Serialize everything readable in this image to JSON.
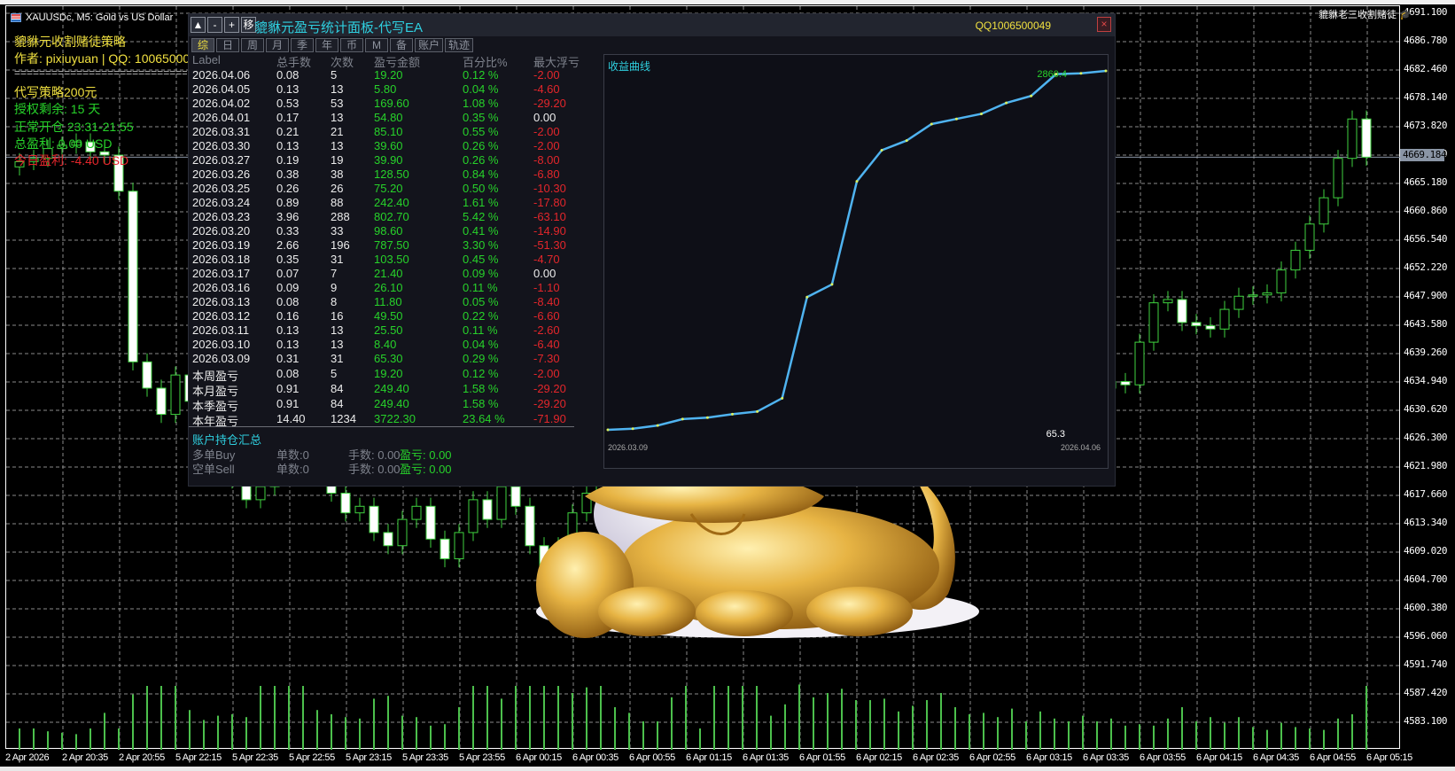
{
  "chart_header": {
    "title": "XAUUSDc, M5:  Gold vs US Dollar",
    "signature": "貔貅老三收割赌徒"
  },
  "overlay": {
    "strategy": "貔貅元收割赌徒策略",
    "author": "作者: pixiuyuan | QQ: 1006500049",
    "divider": "=================================",
    "ad": "代写策略200元",
    "license": "授权剩余: 15 天",
    "hours": "正常开仓 23:31-21:55",
    "total_profit": "总盈利: 0.00 USD",
    "today_profit": "今日盈利: -4.40 USD"
  },
  "price_axis": [
    "4691.100",
    "4686.780",
    "4682.460",
    "4678.140",
    "4673.820",
    "4669.500",
    "4665.180",
    "4660.860",
    "4656.540",
    "4652.220",
    "4647.900",
    "4643.580",
    "4639.260",
    "4634.940",
    "4630.620",
    "4626.300",
    "4621.980",
    "4617.660",
    "4613.340",
    "4609.020",
    "4604.700",
    "4600.380",
    "4596.060",
    "4591.740",
    "4587.420",
    "4583.100"
  ],
  "current_price": "4669.184",
  "time_axis": [
    "2 Apr 2026",
    "2 Apr 20:35",
    "2 Apr 20:55",
    "5 Apr 22:15",
    "5 Apr 22:35",
    "5 Apr 22:55",
    "5 Apr 23:15",
    "5 Apr 23:35",
    "5 Apr 23:55",
    "6 Apr 00:15",
    "6 Apr 00:35",
    "6 Apr 00:55",
    "6 Apr 01:15",
    "6 Apr 01:35",
    "6 Apr 01:55",
    "6 Apr 02:15",
    "6 Apr 02:35",
    "6 Apr 02:55",
    "6 Apr 03:15",
    "6 Apr 03:35",
    "6 Apr 03:55",
    "6 Apr 04:15",
    "6 Apr 04:35",
    "6 Apr 04:55",
    "6 Apr 05:15"
  ],
  "candles_close": [
    4668.5,
    4669,
    4670.5,
    4671,
    4671.5,
    4670,
    4669.5,
    4664,
    4638,
    4634,
    4630,
    4636,
    4632,
    4628,
    4624,
    4620,
    4617,
    4619,
    4622,
    4626,
    4624,
    4621,
    4618,
    4615,
    4616,
    4612,
    4610,
    4614,
    4616,
    4611,
    4608,
    4612,
    4617,
    4614,
    4619,
    4616,
    4610,
    4604,
    4610,
    4615,
    4618,
    4620,
    4622,
    4621,
    4624,
    4626,
    4625,
    4627,
    4629,
    4628,
    4630,
    4632,
    4631,
    4633,
    4634,
    4632,
    4630,
    4633,
    4635,
    4636,
    4634,
    4632,
    4631,
    4633,
    4635,
    4637,
    4636,
    4634,
    4633,
    4632,
    4634,
    4635,
    4633,
    4632,
    4634,
    4633,
    4634,
    4635,
    4634.5,
    4641,
    4647,
    4647.5,
    4644,
    4643.5,
    4643,
    4646,
    4648,
    4648.2,
    4648.5,
    4652,
    4655,
    4659,
    4663,
    4669,
    4675,
    4669.184
  ],
  "volume_levels": [
    30,
    30,
    26,
    24,
    22,
    30,
    52,
    30,
    78,
    90,
    90,
    90,
    56,
    42,
    48,
    50,
    46,
    90,
    90,
    90,
    90,
    56,
    50,
    46,
    44,
    72,
    76,
    48,
    46,
    34,
    36,
    60,
    90,
    90,
    72,
    90,
    90,
    90,
    90,
    80,
    88,
    90,
    60,
    52,
    40,
    40,
    74,
    90,
    30,
    90,
    90,
    90,
    90,
    48,
    64,
    92,
    74,
    80,
    86,
    70,
    70,
    72,
    54,
    62,
    70,
    80,
    60,
    50,
    52,
    46,
    58,
    40,
    54,
    44,
    40,
    48,
    40,
    44,
    34,
    36,
    34,
    44,
    60,
    40,
    46,
    38,
    46,
    32,
    28,
    38,
    32,
    30,
    28,
    44,
    50,
    90
  ],
  "panel": {
    "buttons": [
      "▲",
      "-",
      "+",
      "移"
    ],
    "title": "貔貅元盈亏统计面板-代写EA",
    "qq": "QQ1006500049",
    "close": "×",
    "tabs": [
      "综",
      "日",
      "周",
      "月",
      "季",
      "年",
      "币",
      "M",
      "备",
      "账户",
      "轨迹"
    ],
    "headers": [
      "Label",
      "总手数",
      "次数",
      "盈亏金额",
      "百分比%",
      "最大浮亏"
    ],
    "rows": [
      [
        "2026.04.06",
        "0.08",
        "5",
        "19.20",
        "0.12 %",
        "-2.00"
      ],
      [
        "2026.04.05",
        "0.13",
        "13",
        "5.80",
        "0.04 %",
        "-4.60"
      ],
      [
        "2026.04.02",
        "0.53",
        "53",
        "169.60",
        "1.08 %",
        "-29.20"
      ],
      [
        "2026.04.01",
        "0.17",
        "13",
        "54.80",
        "0.35 %",
        "0.00"
      ],
      [
        "2026.03.31",
        "0.21",
        "21",
        "85.10",
        "0.55 %",
        "-2.00"
      ],
      [
        "2026.03.30",
        "0.13",
        "13",
        "39.60",
        "0.26 %",
        "-2.00"
      ],
      [
        "2026.03.27",
        "0.19",
        "19",
        "39.90",
        "0.26 %",
        "-8.00"
      ],
      [
        "2026.03.26",
        "0.38",
        "38",
        "128.50",
        "0.84 %",
        "-6.80"
      ],
      [
        "2026.03.25",
        "0.26",
        "26",
        "75.20",
        "0.50 %",
        "-10.30"
      ],
      [
        "2026.03.24",
        "0.89",
        "88",
        "242.40",
        "1.61 %",
        "-17.80"
      ],
      [
        "2026.03.23",
        "3.96",
        "288",
        "802.70",
        "5.42 %",
        "-63.10"
      ],
      [
        "2026.03.20",
        "0.33",
        "33",
        "98.60",
        "0.41 %",
        "-14.90"
      ],
      [
        "2026.03.19",
        "2.66",
        "196",
        "787.50",
        "3.30 %",
        "-51.30"
      ],
      [
        "2026.03.18",
        "0.35",
        "31",
        "103.50",
        "0.45 %",
        "-4.70"
      ],
      [
        "2026.03.17",
        "0.07",
        "7",
        "21.40",
        "0.09 %",
        "0.00"
      ],
      [
        "2026.03.16",
        "0.09",
        "9",
        "26.10",
        "0.11 %",
        "-1.10"
      ],
      [
        "2026.03.13",
        "0.08",
        "8",
        "11.80",
        "0.05 %",
        "-8.40"
      ],
      [
        "2026.03.12",
        "0.16",
        "16",
        "49.50",
        "0.22 %",
        "-6.60"
      ],
      [
        "2026.03.11",
        "0.13",
        "13",
        "25.50",
        "0.11 %",
        "-2.60"
      ],
      [
        "2026.03.10",
        "0.13",
        "13",
        "8.40",
        "0.04 %",
        "-6.40"
      ],
      [
        "2026.03.09",
        "0.31",
        "31",
        "65.30",
        "0.29 %",
        "-7.30"
      ]
    ],
    "summary": [
      [
        "本周盈亏",
        "0.08",
        "5",
        "19.20",
        "0.12 %",
        "-2.00"
      ],
      [
        "本月盈亏",
        "0.91",
        "84",
        "249.40",
        "1.58 %",
        "-29.20"
      ],
      [
        "本季盈亏",
        "0.91",
        "84",
        "249.40",
        "1.58 %",
        "-29.20"
      ],
      [
        "本年盈亏",
        "14.40",
        "1234",
        "3722.30",
        "23.64 %",
        "-71.90"
      ]
    ],
    "positions": {
      "title": "账户持仓汇总",
      "buy": {
        "label": "多单Buy",
        "count": "单数:0",
        "lots": "手数: 0.00",
        "pnl": "盈亏: 0.00"
      },
      "sell": {
        "label": "空单Sell",
        "count": "单数:0",
        "lots": "手数: 0.00",
        "pnl": "盈亏: 0.00"
      }
    }
  },
  "chart_data": {
    "type": "line",
    "title": "收益曲线",
    "x": [
      "2026.03.09",
      "2026.03.10",
      "2026.03.11",
      "2026.03.12",
      "2026.03.13",
      "2026.03.16",
      "2026.03.17",
      "2026.03.18",
      "2026.03.19",
      "2026.03.20",
      "2026.03.23",
      "2026.03.24",
      "2026.03.25",
      "2026.03.26",
      "2026.03.27",
      "2026.03.30",
      "2026.03.31",
      "2026.04.01",
      "2026.04.02",
      "2026.04.05",
      "2026.04.06"
    ],
    "y": [
      65.3,
      73.7,
      99.2,
      148.7,
      160.5,
      186.6,
      208.0,
      311.5,
      1099.0,
      1197.6,
      2000.3,
      2242.7,
      2317.9,
      2446.4,
      2486.3,
      2525.9,
      2611.0,
      2665.8,
      2835.4,
      2841.2,
      2860.4
    ],
    "max_label": "2860.4",
    "min_label": "65.3",
    "start_label": "2026.03.09",
    "end_label": "2026.04.06",
    "line_color": "#4fb3f0"
  },
  "colors": {
    "profit": "#27d22a",
    "loss": "#e3262b",
    "accent": "#2fd0e0",
    "highlight": "#f0e040",
    "candle": "#3fd23f"
  }
}
